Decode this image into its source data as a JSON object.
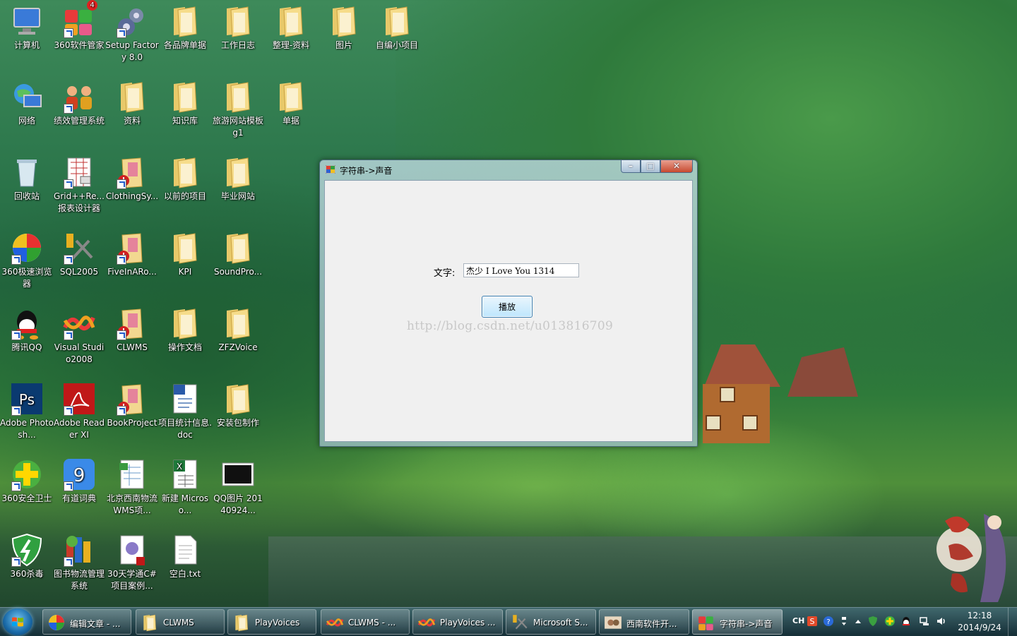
{
  "desktop": {
    "icons": [
      {
        "label": "计算机",
        "icon": "computer-icon"
      },
      {
        "label": "360软件管家",
        "icon": "app-manager-icon",
        "badge": "4"
      },
      {
        "label": "Setup Factory 8.0",
        "icon": "setup-icon"
      },
      {
        "label": "各品牌单据",
        "icon": "folder-icon"
      },
      {
        "label": "工作日志",
        "icon": "folder-icon"
      },
      {
        "label": "整理-资料",
        "icon": "folder-icon"
      },
      {
        "label": "图片",
        "icon": "folder-icon"
      },
      {
        "label": "自编小项目",
        "icon": "folder-icon"
      },
      {
        "label": "网络",
        "icon": "network-icon"
      },
      {
        "label": "绩效管理系统",
        "icon": "people-icon"
      },
      {
        "label": "资料",
        "icon": "folder-icon"
      },
      {
        "label": "知识库",
        "icon": "folder-icon"
      },
      {
        "label": "旅游网站模板g1",
        "icon": "folder-icon"
      },
      {
        "label": "单据",
        "icon": "folder-icon"
      },
      {
        "label": "回收站",
        "icon": "recycle-bin-icon"
      },
      {
        "label": "Grid++Re... 报表设计器",
        "icon": "report-icon"
      },
      {
        "label": "ClothingSy...",
        "icon": "project-icon"
      },
      {
        "label": "以前的项目",
        "icon": "folder-icon"
      },
      {
        "label": "毕业网站",
        "icon": "folder-icon"
      },
      {
        "label": "360极速浏览器",
        "icon": "browser-icon"
      },
      {
        "label": "SQL2005",
        "icon": "sql-icon"
      },
      {
        "label": "FiveInARo...",
        "icon": "project-icon"
      },
      {
        "label": "KPI",
        "icon": "folder-icon"
      },
      {
        "label": "SoundPro...",
        "icon": "folder-icon"
      },
      {
        "label": "腾讯QQ",
        "icon": "qq-icon"
      },
      {
        "label": "Visual Studio2008",
        "icon": "visual-studio-icon"
      },
      {
        "label": "CLWMS",
        "icon": "project-icon"
      },
      {
        "label": "操作文档",
        "icon": "folder-icon"
      },
      {
        "label": "ZFZVoice",
        "icon": "folder-icon"
      },
      {
        "label": "Adobe Photosh...",
        "icon": "photoshop-icon"
      },
      {
        "label": "Adobe Reader XI",
        "icon": "pdf-icon"
      },
      {
        "label": "BookProject",
        "icon": "project-icon"
      },
      {
        "label": "项目统计信息.doc",
        "icon": "word-doc-icon"
      },
      {
        "label": "安装包制作",
        "icon": "folder-icon"
      },
      {
        "label": "360安全卫士",
        "icon": "security-icon"
      },
      {
        "label": "有道词典",
        "icon": "dictionary-icon"
      },
      {
        "label": "北京西南物流WMS项...",
        "icon": "spreadsheet-icon"
      },
      {
        "label": "新建 Microso...",
        "icon": "excel-icon"
      },
      {
        "label": "QQ图片 20140924...",
        "icon": "image-icon"
      },
      {
        "label": "360杀毒",
        "icon": "antivirus-icon"
      },
      {
        "label": "图书物流管理系统",
        "icon": "books-icon"
      },
      {
        "label": "30天学通C# 项目案例...",
        "icon": "book-pdf-icon"
      },
      {
        "label": "空白.txt",
        "icon": "text-file-icon"
      }
    ]
  },
  "window": {
    "title": "字符串->声音",
    "label_text": "文字:",
    "input_value": "杰少 I Love You 1314",
    "play_button": "播放",
    "watermark": "http://blog.csdn.net/u013816709",
    "colors": {
      "button_border": "#3c7fb1",
      "client_bg": "#f0f0f0"
    }
  },
  "taskbar": {
    "items": [
      {
        "label": "编辑文章 - ...",
        "icon": "browser-icon"
      },
      {
        "label": "CLWMS",
        "icon": "folder-icon"
      },
      {
        "label": "PlayVoices",
        "icon": "folder-icon"
      },
      {
        "label": "CLWMS - ...",
        "icon": "visual-studio-icon"
      },
      {
        "label": "PlayVoices ...",
        "icon": "visual-studio-icon"
      },
      {
        "label": "Microsoft S...",
        "icon": "sql-icon"
      },
      {
        "label": "西南软件开...",
        "icon": "chat-icon"
      },
      {
        "label": "字符串->声音",
        "icon": "app-window-icon"
      }
    ],
    "language": "CH",
    "time": "12:18",
    "date": "2014/9/24"
  }
}
